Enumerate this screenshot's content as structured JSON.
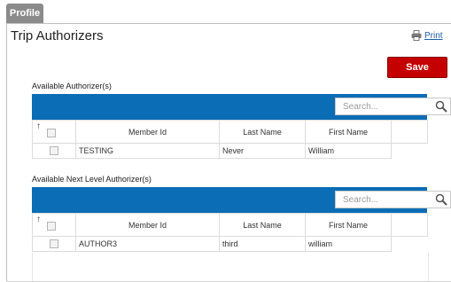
{
  "tab": {
    "label": "Profile"
  },
  "page": {
    "title": "Trip Authorizers",
    "print_label": "Print"
  },
  "actions": {
    "save_label": "Save"
  },
  "sections": [
    {
      "label": "Available Authorizer(s)",
      "search_placeholder": "Search...",
      "columns": [
        "Member Id",
        "Last Name",
        "First Name"
      ],
      "rows": [
        {
          "member_id": "TESTING",
          "last_name": "Never",
          "first_name": "William"
        }
      ]
    },
    {
      "label": "Available Next Level Authorizer(s)",
      "search_placeholder": "Search...",
      "columns": [
        "Member Id",
        "Last Name",
        "First Name"
      ],
      "rows": [
        {
          "member_id": "AUTHOR3",
          "last_name": "third",
          "first_name": "william"
        }
      ]
    }
  ],
  "colors": {
    "grid_header": "#0a6db5",
    "save_button": "#c40000",
    "link": "#1f5fa8"
  }
}
